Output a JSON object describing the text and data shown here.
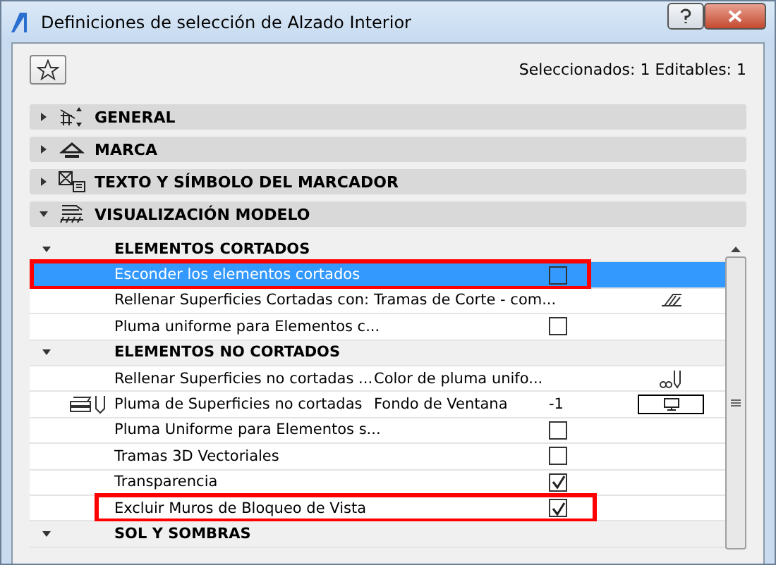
{
  "window": {
    "title": "Definiciones de selección de Alzado Interior"
  },
  "counts": "Seleccionados: 1 Editables: 1",
  "sections": [
    {
      "label": "GENERAL",
      "expanded": false
    },
    {
      "label": "MARCA",
      "expanded": false
    },
    {
      "label": "TEXTO Y SÍMBOLO DEL MARCADOR",
      "expanded": false
    },
    {
      "label": "VISUALIZACIÓN MODELO",
      "expanded": true
    }
  ],
  "rows": [
    {
      "kind": "group",
      "label": "ELEMENTOS CORTADOS",
      "expanded": true
    },
    {
      "kind": "check",
      "label": "Esconder los elementos cortados",
      "checked": false,
      "selected": true,
      "highlighted": true
    },
    {
      "kind": "value",
      "label": "Rellenar Superficies Cortadas con:",
      "value": "Tramas de Corte - com...",
      "selected": false,
      "highlighted": false
    },
    {
      "kind": "check",
      "label": "Pluma uniforme para Elementos c...",
      "checked": false,
      "selected": false,
      "highlighted": false
    },
    {
      "kind": "group",
      "label": "ELEMENTOS NO CORTADOS",
      "expanded": true
    },
    {
      "kind": "value",
      "label": "Rellenar Superficies no cortadas ...",
      "value": "Color de pluma unifo...",
      "selected": false,
      "highlighted": false
    },
    {
      "kind": "value",
      "label": "Pluma de Superficies no cortadas",
      "value": "Fondo de Ventana",
      "number": "-1",
      "selected": false,
      "highlighted": false
    },
    {
      "kind": "check",
      "label": "Pluma Uniforme para Elementos s...",
      "checked": false,
      "selected": false,
      "highlighted": false
    },
    {
      "kind": "check",
      "label": "Tramas 3D Vectoriales",
      "checked": false,
      "selected": false,
      "highlighted": false
    },
    {
      "kind": "check",
      "label": "Transparencia",
      "checked": true,
      "selected": false,
      "highlighted": false
    },
    {
      "kind": "check",
      "label": "Excluir Muros de Bloqueo de Vista",
      "checked": true,
      "selected": false,
      "highlighted": true
    },
    {
      "kind": "group",
      "label": "SOL Y SOMBRAS",
      "expanded": true
    }
  ]
}
